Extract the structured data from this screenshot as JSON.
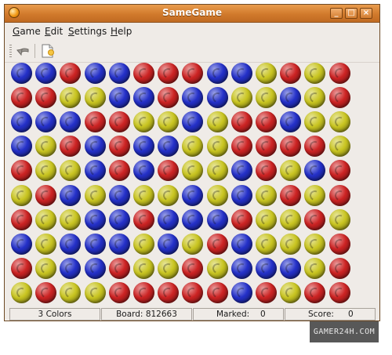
{
  "window": {
    "title": "SameGame"
  },
  "menu": [
    "Game",
    "Edit",
    "Settings",
    "Help"
  ],
  "toolbar": {
    "undo_icon": "undo-icon",
    "new_game_icon": "new-game-icon"
  },
  "colors": {
    "r": "#cc2323",
    "b": "#2430c8",
    "y": "#c9c521"
  },
  "board": {
    "rows": [
      "bbrbbrrrbbyryr",
      "rryybbrbbyybyr",
      "bbbrryybyrrbyy",
      "byrbrbbyyrrrry",
      "ryybrbryybrybr",
      "yrbybyybybyryr",
      "ryybbrbbbryyry",
      "bybbbybyrbyyyr",
      "rybbryyrybbbyr",
      "yryyrrrrrbryrr"
    ]
  },
  "status": {
    "colors": "3 Colors",
    "board": "Board: 812663",
    "marked_label": "Marked:",
    "marked_value": "0",
    "score_label": "Score:",
    "score_value": "0"
  },
  "watermark": "GAMER24H.COM"
}
